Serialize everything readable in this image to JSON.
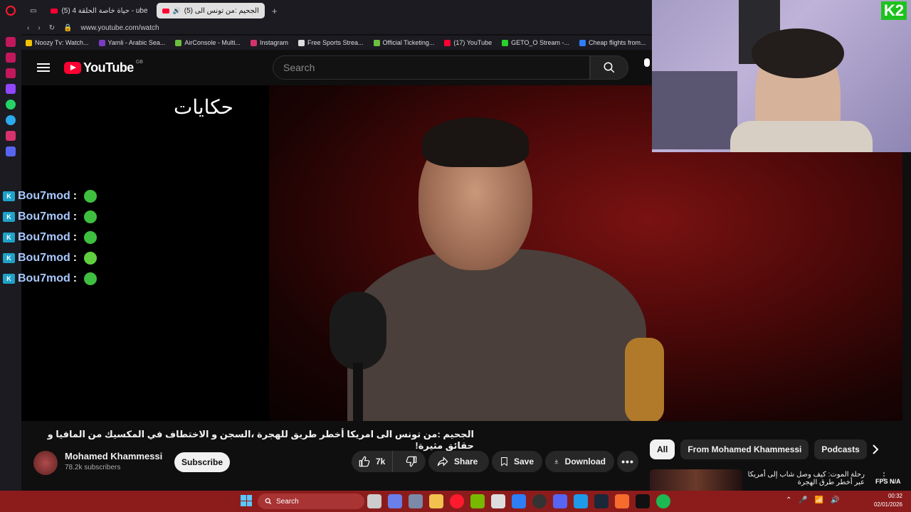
{
  "browser": {
    "tabs": [
      {
        "label": "(5) حياة خاصة الحلقة 4 - ube",
        "active": false
      },
      {
        "label": "(5) الجحيم :من تونس الى",
        "active": true
      }
    ],
    "url": "www.youtube.com/watch",
    "bookmarks": [
      {
        "label": "Noozy Tv: Watch...",
        "color": "#f2c200"
      },
      {
        "label": "Yamli - Arabic Sea...",
        "color": "#7a3cc4"
      },
      {
        "label": "AirConsole - Multi...",
        "color": "#6cbf3c"
      },
      {
        "label": "Instagram",
        "color": "#d6336c"
      },
      {
        "label": "Free Sports Strea...",
        "color": "#dddddd"
      },
      {
        "label": "Official Ticketing...",
        "color": "#6cbf3c"
      },
      {
        "label": "(17) YouTube",
        "color": "#ff0033"
      },
      {
        "label": "GETO_O Stream -...",
        "color": "#29d22a"
      },
      {
        "label": "Cheap flights from...",
        "color": "#2d7ef7"
      }
    ]
  },
  "youtube": {
    "logo_text": "YouTube",
    "country_code": "GB",
    "search_placeholder": "Search"
  },
  "video": {
    "watermark": "حكايات",
    "chat": [
      {
        "badge": "K",
        "name": "Bou7mod",
        "sep": ":"
      },
      {
        "badge": "K",
        "name": "Bou7mod",
        "sep": ":"
      },
      {
        "badge": "K",
        "name": "Bou7mod",
        "sep": ":"
      },
      {
        "badge": "K",
        "name": "Bou7mod",
        "sep": ":"
      },
      {
        "badge": "K",
        "name": "Bou7mod",
        "sep": ":"
      }
    ],
    "title": "الجحيم :من تونس الى امريكا أخطر طريق للهجرة ،السجن و الاختطاف في المكسيك من المافيا و حقائق مثيرة!"
  },
  "webcam": {
    "logo": "K2"
  },
  "channel": {
    "name": "Mohamed Khammessi",
    "subscribers": "78.2k subscribers",
    "subscribe_label": "Subscribe"
  },
  "actions": {
    "like_count": "7k",
    "share_label": "Share",
    "save_label": "Save",
    "download_label": "Download"
  },
  "chips": [
    {
      "label": "All",
      "active": true
    },
    {
      "label": "From Mohamed Khammessi",
      "active": false
    },
    {
      "label": "Podcasts",
      "active": false
    }
  ],
  "recommendation": {
    "title": "رحلة الموت: كيف وصل شاب إلى أمريكا عبر أخطر طرق الهجرة"
  },
  "overlay": {
    "fps": "FPS N/A"
  },
  "taskbar": {
    "search_label": "Search",
    "time": "00:32",
    "date": "02/01/2026"
  }
}
